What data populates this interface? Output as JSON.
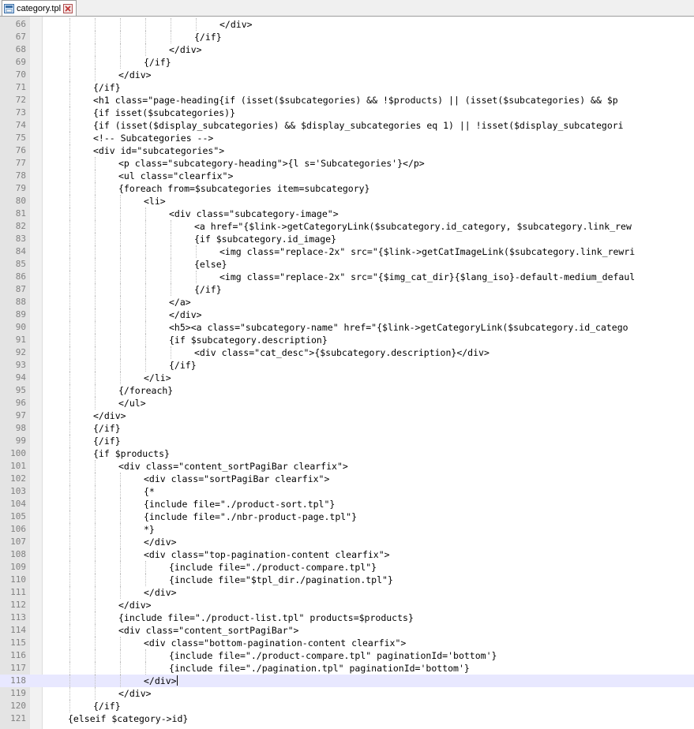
{
  "tab": {
    "title": "category.tpl",
    "icon": "file-icon",
    "close_icon": "close-icon"
  },
  "colors": {
    "gutter": "#e4e4e4",
    "line_number": "#808080",
    "current_line": "#e8e8ff",
    "tab_close": "#c03030"
  },
  "editor": {
    "current_line": 118,
    "lines": [
      {
        "n": "66",
        "indent": 7,
        "text": "</div>"
      },
      {
        "n": "67",
        "indent": 6,
        "text": "{/if}"
      },
      {
        "n": "68",
        "indent": 5,
        "text": "</div>"
      },
      {
        "n": "69",
        "indent": 4,
        "text": "{/if}"
      },
      {
        "n": "70",
        "indent": 3,
        "text": "</div>"
      },
      {
        "n": "71",
        "indent": 2,
        "text": "{/if}"
      },
      {
        "n": "72",
        "indent": 2,
        "text": "<h1 class=\"page-heading{if (isset($subcategories) && !$products) || (isset($subcategories) && $p"
      },
      {
        "n": "73",
        "indent": 2,
        "text": "{if isset($subcategories)}"
      },
      {
        "n": "74",
        "indent": 2,
        "text": "{if (isset($display_subcategories) && $display_subcategories eq 1) || !isset($display_subcategori"
      },
      {
        "n": "75",
        "indent": 2,
        "text": "<!-- Subcategories -->"
      },
      {
        "n": "76",
        "indent": 2,
        "text": "<div id=\"subcategories\">"
      },
      {
        "n": "77",
        "indent": 3,
        "text": "<p class=\"subcategory-heading\">{l s='Subcategories'}</p>"
      },
      {
        "n": "78",
        "indent": 3,
        "text": "<ul class=\"clearfix\">"
      },
      {
        "n": "79",
        "indent": 3,
        "text": "{foreach from=$subcategories item=subcategory}"
      },
      {
        "n": "80",
        "indent": 4,
        "text": "<li>"
      },
      {
        "n": "81",
        "indent": 5,
        "text": "<div class=\"subcategory-image\">"
      },
      {
        "n": "82",
        "indent": 6,
        "text": "<a href=\"{$link->getCategoryLink($subcategory.id_category, $subcategory.link_rew"
      },
      {
        "n": "83",
        "indent": 6,
        "text": "{if $subcategory.id_image}"
      },
      {
        "n": "84",
        "indent": 7,
        "text": "<img class=\"replace-2x\" src=\"{$link->getCatImageLink($subcategory.link_rewri"
      },
      {
        "n": "85",
        "indent": 6,
        "text": "{else}"
      },
      {
        "n": "86",
        "indent": 7,
        "text": "<img class=\"replace-2x\" src=\"{$img_cat_dir}{$lang_iso}-default-medium_defaul"
      },
      {
        "n": "87",
        "indent": 6,
        "text": "{/if}"
      },
      {
        "n": "88",
        "indent": 5,
        "text": "</a>"
      },
      {
        "n": "89",
        "indent": 5,
        "text": "</div>"
      },
      {
        "n": "90",
        "indent": 5,
        "text": "<h5><a class=\"subcategory-name\" href=\"{$link->getCategoryLink($subcategory.id_catego"
      },
      {
        "n": "91",
        "indent": 5,
        "text": "{if $subcategory.description}"
      },
      {
        "n": "92",
        "indent": 6,
        "text": "<div class=\"cat_desc\">{$subcategory.description}</div>"
      },
      {
        "n": "93",
        "indent": 5,
        "text": "{/if}"
      },
      {
        "n": "94",
        "indent": 4,
        "text": "</li>"
      },
      {
        "n": "95",
        "indent": 3,
        "text": "{/foreach}"
      },
      {
        "n": "96",
        "indent": 3,
        "text": "</ul>"
      },
      {
        "n": "97",
        "indent": 2,
        "text": "</div>"
      },
      {
        "n": "98",
        "indent": 2,
        "text": "{/if}"
      },
      {
        "n": "99",
        "indent": 2,
        "text": "{/if}"
      },
      {
        "n": "100",
        "indent": 2,
        "text": "{if $products}"
      },
      {
        "n": "101",
        "indent": 3,
        "text": "<div class=\"content_sortPagiBar clearfix\">"
      },
      {
        "n": "102",
        "indent": 4,
        "text": "<div class=\"sortPagiBar clearfix\">"
      },
      {
        "n": "103",
        "indent": 4,
        "text": "{*"
      },
      {
        "n": "104",
        "indent": 4,
        "text": "{include file=\"./product-sort.tpl\"}"
      },
      {
        "n": "105",
        "indent": 4,
        "text": "{include file=\"./nbr-product-page.tpl\"}"
      },
      {
        "n": "106",
        "indent": 4,
        "text": "*}"
      },
      {
        "n": "107",
        "indent": 4,
        "text": "</div>"
      },
      {
        "n": "108",
        "indent": 4,
        "text": "<div class=\"top-pagination-content clearfix\">"
      },
      {
        "n": "109",
        "indent": 5,
        "text": "{include file=\"./product-compare.tpl\"}"
      },
      {
        "n": "110",
        "indent": 5,
        "text": "{include file=\"$tpl_dir./pagination.tpl\"}"
      },
      {
        "n": "111",
        "indent": 4,
        "text": "</div>"
      },
      {
        "n": "112",
        "indent": 3,
        "text": "</div>"
      },
      {
        "n": "113",
        "indent": 3,
        "text": "{include file=\"./product-list.tpl\" products=$products}"
      },
      {
        "n": "114",
        "indent": 3,
        "text": "<div class=\"content_sortPagiBar\">"
      },
      {
        "n": "115",
        "indent": 4,
        "text": "<div class=\"bottom-pagination-content clearfix\">"
      },
      {
        "n": "116",
        "indent": 5,
        "text": "{include file=\"./product-compare.tpl\" paginationId='bottom'}"
      },
      {
        "n": "117",
        "indent": 5,
        "text": "{include file=\"./pagination.tpl\" paginationId='bottom'}"
      },
      {
        "n": "118",
        "indent": 4,
        "text": "</div>"
      },
      {
        "n": "119",
        "indent": 3,
        "text": "</div>"
      },
      {
        "n": "120",
        "indent": 2,
        "text": "{/if}"
      },
      {
        "n": "121",
        "indent": 1,
        "text": "{elseif $category->id}"
      }
    ]
  }
}
